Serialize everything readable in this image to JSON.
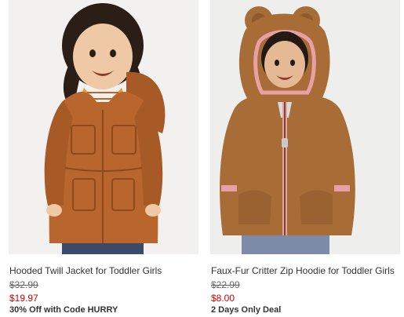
{
  "products": [
    {
      "name": "Hooded Twill Jacket for Toddler Girls",
      "regular_price": "$32.99",
      "sale_price": "$19.97",
      "promo": "30% Off with Code HURRY",
      "image": {
        "subject": "toddler girl in rust-brown hooded twill jacket",
        "colors": {
          "jacket": "#b8662d",
          "background": "#f3f1ef"
        }
      }
    },
    {
      "name": "Faux-Fur Critter Zip Hoodie for Toddler Girls",
      "regular_price": "$22.99",
      "sale_price": "$8.00",
      "promo": "2 Days Only Deal",
      "image": {
        "subject": "toddler girl in brown faux-fur bear-ear zip hoodie",
        "colors": {
          "hoodie": "#a86d37",
          "trim": "#e7a1a6",
          "background": "#eeeeec"
        }
      }
    }
  ],
  "colors": {
    "sale_red": "#cc0000",
    "text": "#333333",
    "strike": "#666666"
  }
}
